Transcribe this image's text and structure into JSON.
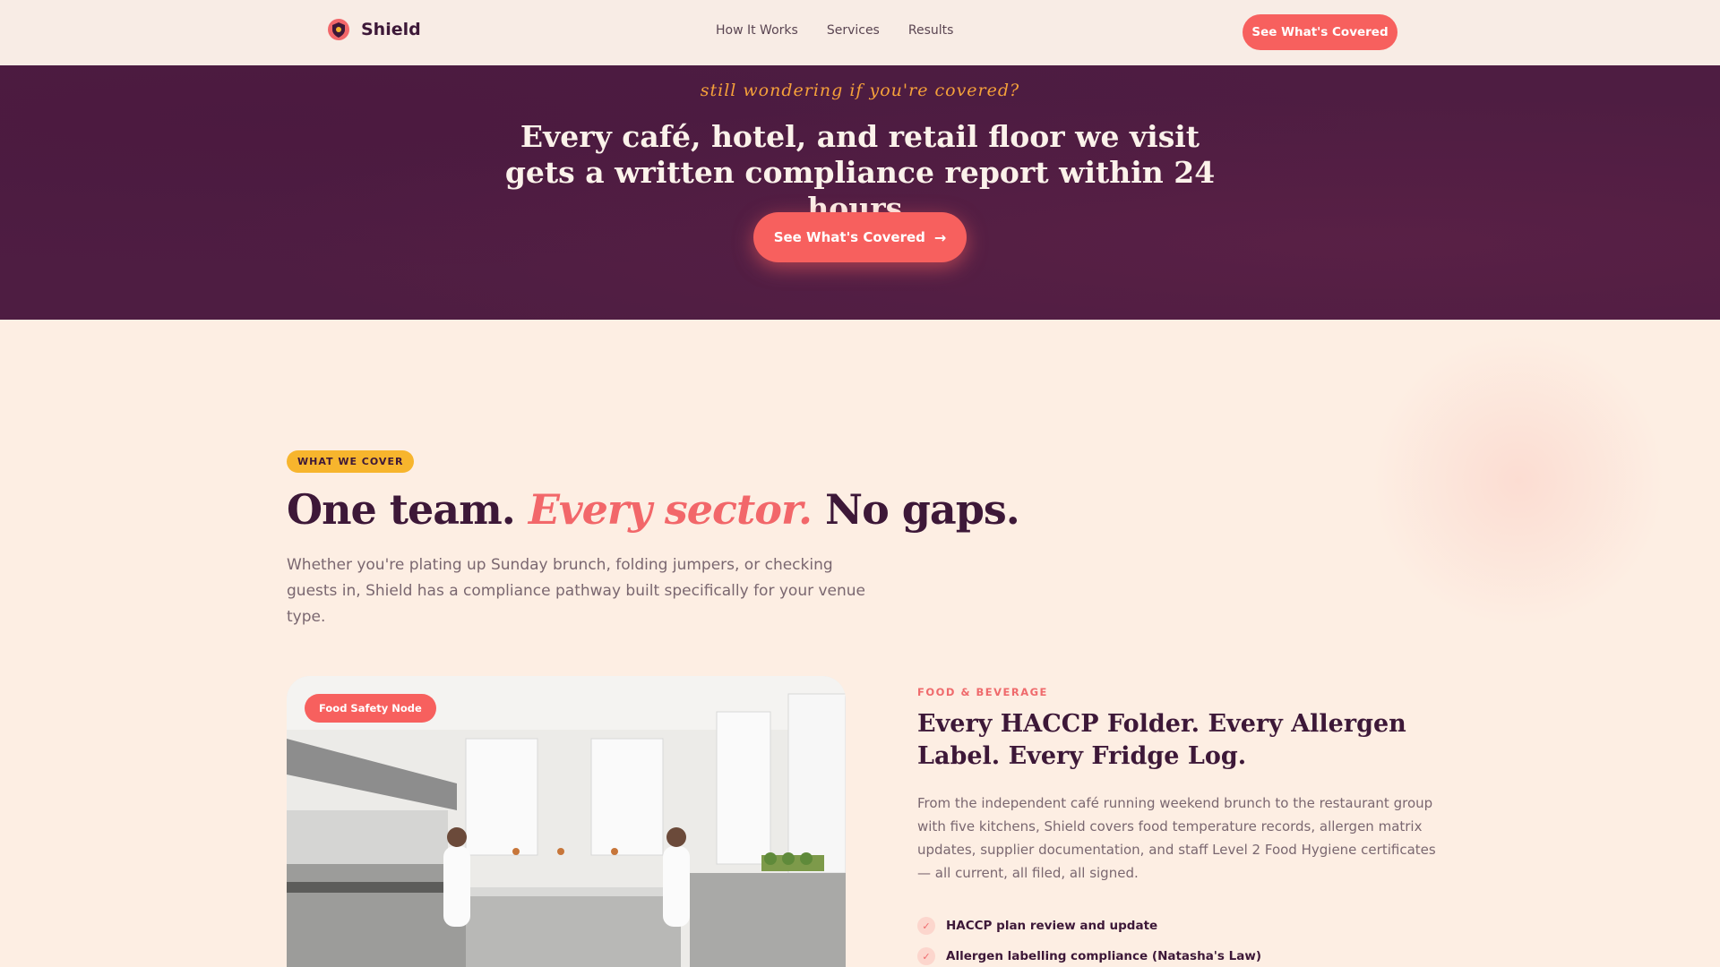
{
  "nav": {
    "brand": "Shield",
    "links": [
      "How It Works",
      "Services",
      "Results"
    ],
    "cta": "See What's Covered"
  },
  "banner": {
    "script": "still wondering if you're covered?",
    "title": "Every café, hotel, and retail floor we visit gets a written compliance report within 24 hours.",
    "cta": "See What's Covered"
  },
  "section": {
    "pill": "WHAT WE COVER",
    "headline_a": "One team.",
    "headline_b": "Every sector.",
    "headline_c": "No gaps.",
    "lead": "Whether you're plating up Sunday brunch, folding jumpers, or checking guests in, Shield has a compliance pathway built specifically for your venue type."
  },
  "card": {
    "photo_tag": "Food Safety Node",
    "label": "FOOD & BEVERAGE",
    "title": "Every HACCP Folder. Every Allergen Label. Every Fridge Log.",
    "body": "From the independent café running weekend brunch to the restaurant group with five kitchens, Shield covers food temperature records, allergen matrix updates, supplier documentation, and staff Level 2 Food Hygiene certificates — all current, all filed, all signed.",
    "checks": [
      "HACCP plan review and update",
      "Allergen labelling compliance (Natasha's Law)"
    ]
  },
  "colors": {
    "accent": "#f7605e",
    "banner": "#4e1d42",
    "ink": "#3d1838",
    "pill": "#f7b52d",
    "page": "#fdeee3"
  },
  "icons": [
    "shield-logo-icon",
    "arrow-right-icon",
    "check-icon"
  ]
}
